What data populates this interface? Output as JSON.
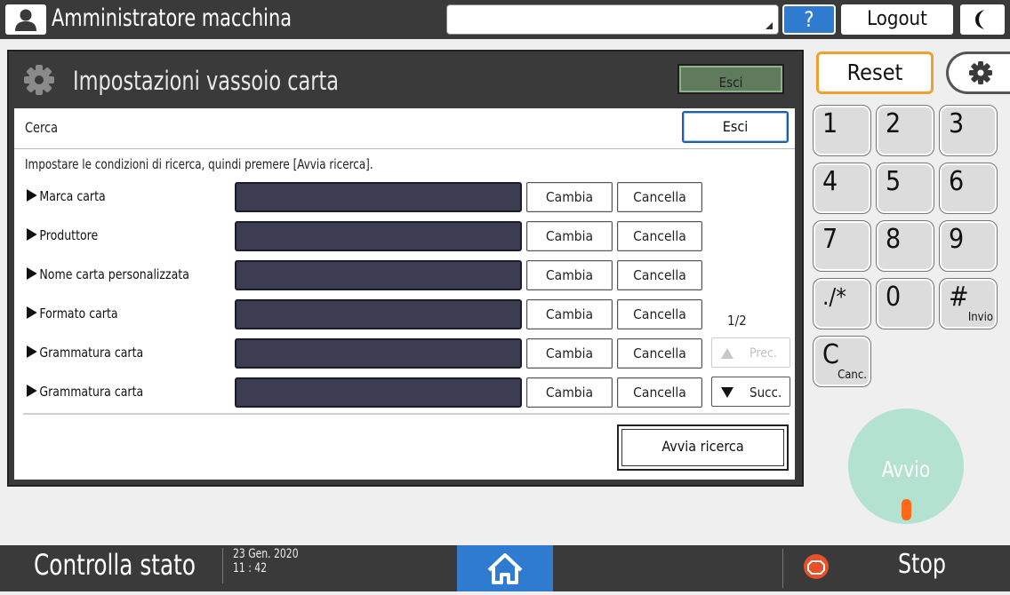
{
  "topbar": {
    "title": "Amministratore macchina",
    "help": "?",
    "logout": "Logout"
  },
  "panel": {
    "title": "Impostazioni vassoio carta",
    "exit": "Esci"
  },
  "search": {
    "label": "Cerca",
    "exit": "Esci",
    "instructions": "Impostare le condizioni di ricerca, quindi premere [Avvia ricerca].",
    "rows": [
      {
        "label": "Marca carta",
        "change": "Cambia",
        "clear": "Cancella"
      },
      {
        "label": "Produttore",
        "change": "Cambia",
        "clear": "Cancella"
      },
      {
        "label": "Nome carta personalizzata",
        "change": "Cambia",
        "clear": "Cancella"
      },
      {
        "label": "Formato carta",
        "change": "Cambia",
        "clear": "Cancella"
      },
      {
        "label": "Grammatura carta",
        "change": "Cambia",
        "clear": "Cancella"
      },
      {
        "label": "Grammatura carta",
        "change": "Cambia",
        "clear": "Cancella"
      }
    ],
    "page_indicator": "1/2",
    "prev": "Prec.",
    "next": "Succ.",
    "start": "Avvia ricerca"
  },
  "keypad": {
    "reset": "Reset",
    "keys": [
      {
        "label": "1"
      },
      {
        "label": "2"
      },
      {
        "label": "3"
      },
      {
        "label": "4"
      },
      {
        "label": "5"
      },
      {
        "label": "6"
      },
      {
        "label": "7"
      },
      {
        "label": "8"
      },
      {
        "label": "9"
      },
      {
        "label": "./*"
      },
      {
        "label": "0"
      },
      {
        "label": "#",
        "sub": "Invio"
      },
      {
        "label": "C",
        "sub": "Canc."
      }
    ],
    "start": "Avvio"
  },
  "bottombar": {
    "status": "Controlla stato",
    "date": "23 Gen. 2020",
    "time": "11 : 42",
    "stop": "Stop"
  },
  "colors": {
    "bar": "#3a3a3a",
    "accent_blue": "#2e7bd0",
    "reset_border": "#f0a030",
    "field": "#3c3c52",
    "start_green": "#b3e2d1",
    "stop_red": "#e8502a"
  },
  "icons": [
    "user-icon",
    "gear-icon",
    "moon-icon",
    "home-icon",
    "stop-icon"
  ]
}
